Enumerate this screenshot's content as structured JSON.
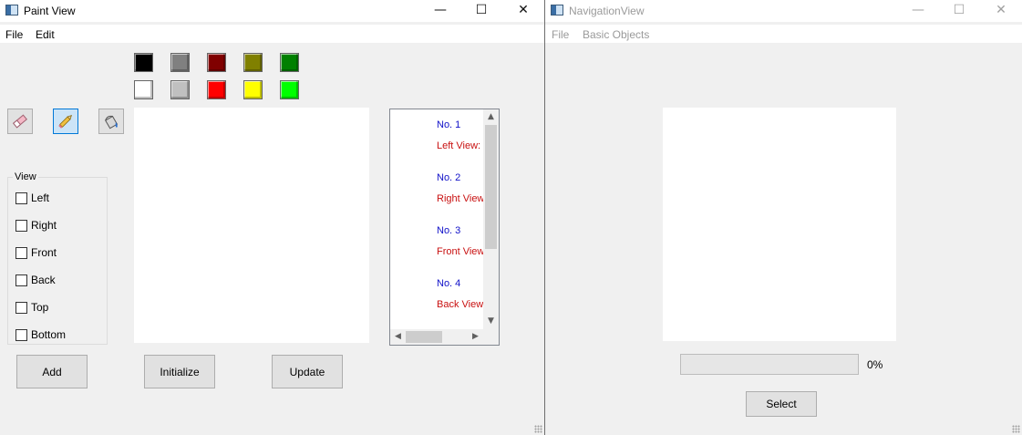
{
  "paint_window": {
    "title": "Paint View",
    "menu": [
      "File",
      "Edit"
    ],
    "controls": {
      "minimize": "—",
      "maximize": "☐",
      "close": "✕"
    },
    "palette_row1": [
      "#000000",
      "#808080",
      "#800000",
      "#808000",
      "#008000"
    ],
    "palette_row2": [
      "#ffffff",
      "#c0c0c0",
      "#ff0000",
      "#ffff00",
      "#00ff00"
    ],
    "tools": [
      {
        "name": "eraser-icon",
        "active": false
      },
      {
        "name": "pencil-icon",
        "active": true
      },
      {
        "name": "paint-bucket-icon",
        "active": false
      }
    ],
    "view_group": {
      "title": "View",
      "options": [
        "Left",
        "Right",
        "Front",
        "Back",
        "Top",
        "Bottom"
      ]
    },
    "list_items": [
      {
        "no": "No. 1",
        "view": "Left View:"
      },
      {
        "no": "No. 2",
        "view": "Right View"
      },
      {
        "no": "No. 3",
        "view": "Front View"
      },
      {
        "no": "No. 4",
        "view": "Back View:"
      }
    ],
    "buttons": {
      "add": "Add",
      "initialize": "Initialize",
      "update": "Update"
    }
  },
  "nav_window": {
    "title": "NavigationView",
    "menu": [
      "File",
      "Basic Objects"
    ],
    "controls": {
      "minimize": "—",
      "maximize": "☐",
      "close": "✕"
    },
    "progress": {
      "value": 0,
      "label": "0%"
    },
    "select_button": "Select"
  }
}
